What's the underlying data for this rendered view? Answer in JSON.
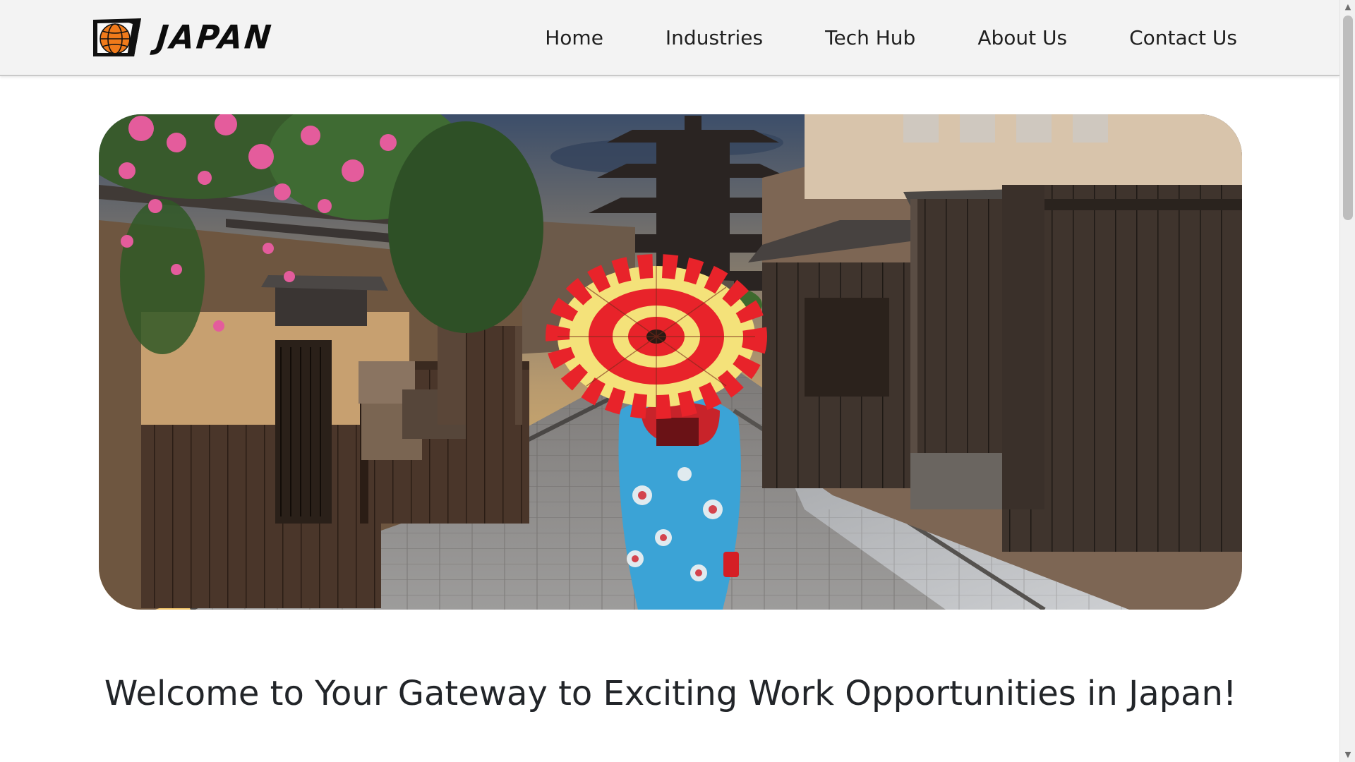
{
  "brand": {
    "name": "JAPAN",
    "logo_icon": "globe-flag-icon",
    "logo_colors": {
      "globe": "#f07a1a",
      "frame": "#111111"
    }
  },
  "nav": {
    "items": [
      {
        "label": "Home"
      },
      {
        "label": "Industries"
      },
      {
        "label": "Tech Hub"
      },
      {
        "label": "About Us"
      },
      {
        "label": "Contact Us"
      }
    ]
  },
  "hero": {
    "image_subject": "kyoto-street-pagoda-kimono-umbrella-image",
    "colors": {
      "umbrella_red": "#e8232a",
      "umbrella_yellow": "#f4e27a",
      "kimono_blue": "#3ba3d6"
    }
  },
  "main": {
    "heading": "Welcome to Your Gateway to Exciting Work Opportunities in Japan!"
  },
  "scrollbar": {
    "up_icon": "scroll-up-arrow-icon",
    "down_icon": "scroll-down-arrow-icon"
  }
}
